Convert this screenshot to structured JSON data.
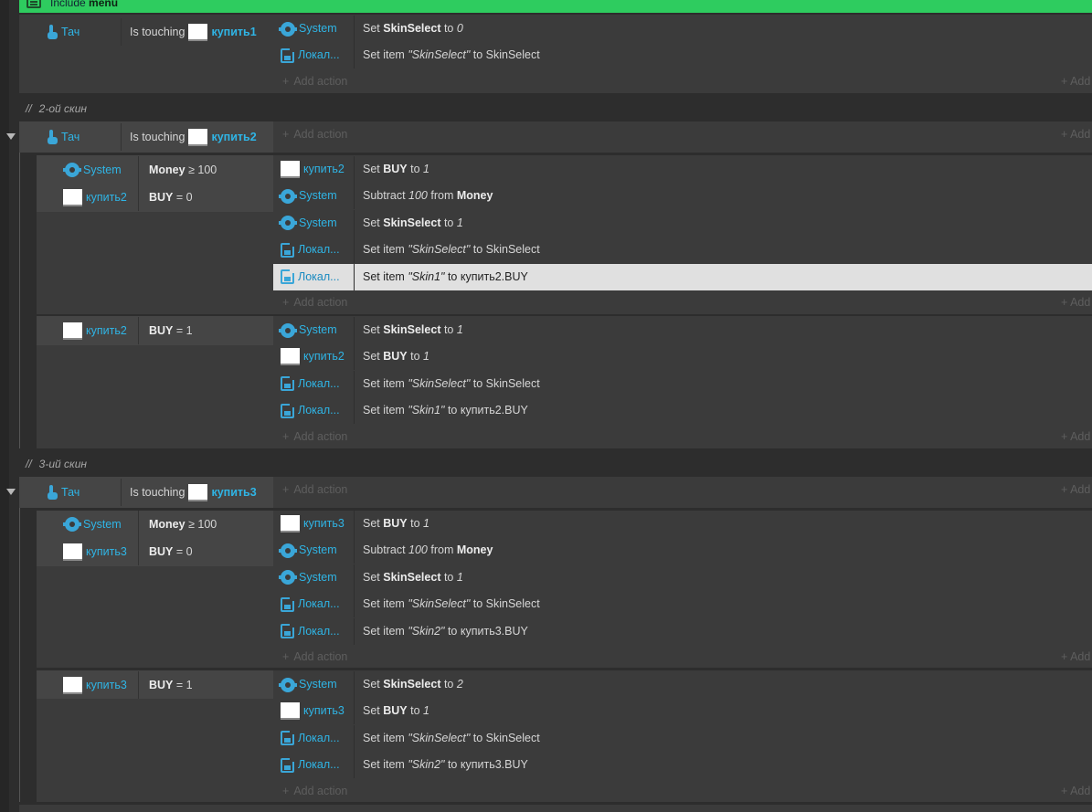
{
  "include": {
    "prefix": "Include",
    "name": "menu"
  },
  "comments": {
    "skin2": "2-ой скин",
    "skin3": "3-ий скин"
  },
  "add_action_label": "Add action",
  "add_right_label": "Add",
  "event1": {
    "trigger_obj": "Тач",
    "trigger_text": "Is touching",
    "trigger_target": "купить1",
    "actions": [
      {
        "obj": "System",
        "icon": "gear-icon",
        "pre": "Set ",
        "b1": "SkinSelect",
        "mid": " to ",
        "i1": "0",
        "post": ""
      },
      {
        "obj": "Локал...",
        "icon": "local-storage-icon",
        "pre": "Set item ",
        "b1": "",
        "mid": "",
        "i1": "\"SkinSelect\"",
        "post": " to SkinSelect"
      }
    ]
  },
  "event2": {
    "trigger_obj": "Тач",
    "trigger_text": "Is touching",
    "trigger_target": "купить2",
    "sub1": {
      "conditions": [
        {
          "obj": "System",
          "icon": "gear-icon",
          "b1": "Money",
          "rest": " ≥ 100"
        },
        {
          "obj": "купить2",
          "icon": "sprite-icon",
          "b1": "BUY",
          "rest": " = 0"
        }
      ],
      "actions": [
        {
          "obj": "купить2",
          "icon": "sprite-icon",
          "pre": "Set ",
          "b1": "BUY",
          "mid": " to ",
          "i1": "1",
          "post": ""
        },
        {
          "obj": "System",
          "icon": "gear-icon",
          "pre": "Subtract ",
          "b1": "",
          "mid": "",
          "i1": "100",
          "post": " from ",
          "b2": "Money"
        },
        {
          "obj": "System",
          "icon": "gear-icon",
          "pre": "Set ",
          "b1": "SkinSelect",
          "mid": " to ",
          "i1": "1",
          "post": ""
        },
        {
          "obj": "Локал...",
          "icon": "local-storage-icon",
          "pre": "Set item ",
          "b1": "",
          "mid": "",
          "i1": "\"SkinSelect\"",
          "post": " to SkinSelect"
        },
        {
          "obj": "Локал...",
          "icon": "local-storage-icon",
          "pre": "Set item ",
          "b1": "",
          "mid": "",
          "i1": "\"Skin1\"",
          "post": " to купить2.BUY"
        }
      ]
    },
    "sub2": {
      "conditions": [
        {
          "obj": "купить2",
          "icon": "sprite-icon",
          "b1": "BUY",
          "rest": " = 1"
        }
      ],
      "actions": [
        {
          "obj": "System",
          "icon": "gear-icon",
          "pre": "Set ",
          "b1": "SkinSelect",
          "mid": " to ",
          "i1": "1",
          "post": ""
        },
        {
          "obj": "купить2",
          "icon": "sprite-icon",
          "pre": "Set ",
          "b1": "BUY",
          "mid": " to ",
          "i1": "1",
          "post": ""
        },
        {
          "obj": "Локал...",
          "icon": "local-storage-icon",
          "pre": "Set item ",
          "b1": "",
          "mid": "",
          "i1": "\"SkinSelect\"",
          "post": " to SkinSelect"
        },
        {
          "obj": "Локал...",
          "icon": "local-storage-icon",
          "pre": "Set item ",
          "b1": "",
          "mid": "",
          "i1": "\"Skin1\"",
          "post": " to купить2.BUY"
        }
      ]
    }
  },
  "event3": {
    "trigger_obj": "Тач",
    "trigger_text": "Is touching",
    "trigger_target": "купить3",
    "sub1": {
      "conditions": [
        {
          "obj": "System",
          "icon": "gear-icon",
          "b1": "Money",
          "rest": " ≥ 100"
        },
        {
          "obj": "купить3",
          "icon": "sprite-icon",
          "b1": "BUY",
          "rest": " = 0"
        }
      ],
      "actions": [
        {
          "obj": "купить3",
          "icon": "sprite-icon",
          "pre": "Set ",
          "b1": "BUY",
          "mid": " to ",
          "i1": "1",
          "post": ""
        },
        {
          "obj": "System",
          "icon": "gear-icon",
          "pre": "Subtract ",
          "b1": "",
          "mid": "",
          "i1": "100",
          "post": " from ",
          "b2": "Money"
        },
        {
          "obj": "System",
          "icon": "gear-icon",
          "pre": "Set ",
          "b1": "SkinSelect",
          "mid": " to ",
          "i1": "1",
          "post": ""
        },
        {
          "obj": "Локал...",
          "icon": "local-storage-icon",
          "pre": "Set item ",
          "b1": "",
          "mid": "",
          "i1": "\"SkinSelect\"",
          "post": " to SkinSelect"
        },
        {
          "obj": "Локал...",
          "icon": "local-storage-icon",
          "pre": "Set item ",
          "b1": "",
          "mid": "",
          "i1": "\"Skin2\"",
          "post": " to купить3.BUY"
        }
      ]
    },
    "sub2": {
      "conditions": [
        {
          "obj": "купить3",
          "icon": "sprite-icon",
          "b1": "BUY",
          "rest": " = 1"
        }
      ],
      "actions": [
        {
          "obj": "System",
          "icon": "gear-icon",
          "pre": "Set ",
          "b1": "SkinSelect",
          "mid": " to ",
          "i1": "2",
          "post": ""
        },
        {
          "obj": "купить3",
          "icon": "sprite-icon",
          "pre": "Set ",
          "b1": "BUY",
          "mid": " to ",
          "i1": "1",
          "post": ""
        },
        {
          "obj": "Локал...",
          "icon": "local-storage-icon",
          "pre": "Set item ",
          "b1": "",
          "mid": "",
          "i1": "\"SkinSelect\"",
          "post": " to SkinSelect"
        },
        {
          "obj": "Локал...",
          "icon": "local-storage-icon",
          "pre": "Set item ",
          "b1": "",
          "mid": "",
          "i1": "\"Skin2\"",
          "post": " to купить3.BUY"
        }
      ]
    }
  }
}
